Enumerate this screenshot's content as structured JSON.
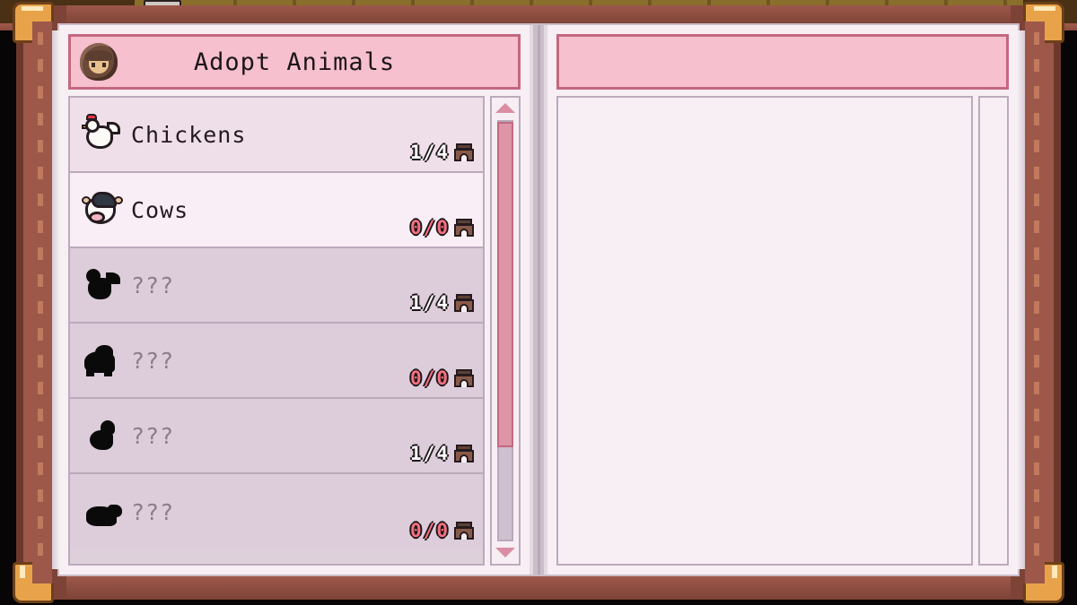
{
  "world": {
    "item_icon": "crown-item-icon"
  },
  "book": {
    "left_page": {
      "header": {
        "avatar_icon": "player-portrait-icon",
        "title": "Adopt Animals"
      },
      "rows": [
        {
          "icon": "chicken-icon",
          "label": "Chickens",
          "locked": false,
          "selected": false,
          "count": "1",
          "separator": "/",
          "capacity": "4",
          "count_state": "ok",
          "building_icon": "coop-icon"
        },
        {
          "icon": "cow-icon",
          "label": "Cows",
          "locked": false,
          "selected": true,
          "count": "0",
          "separator": "/",
          "capacity": "0",
          "count_state": "full",
          "building_icon": "barn-icon"
        },
        {
          "icon": "locked-chicken-silhouette-icon",
          "label": "???",
          "locked": true,
          "selected": false,
          "count": "1",
          "separator": "/",
          "capacity": "4",
          "count_state": "ok",
          "building_icon": "coop-icon"
        },
        {
          "icon": "locked-sheep-silhouette-icon",
          "label": "???",
          "locked": true,
          "selected": false,
          "count": "0",
          "separator": "/",
          "capacity": "0",
          "count_state": "full",
          "building_icon": "barn-icon"
        },
        {
          "icon": "locked-duck-silhouette-icon",
          "label": "???",
          "locked": true,
          "selected": false,
          "count": "1",
          "separator": "/",
          "capacity": "4",
          "count_state": "ok",
          "building_icon": "coop-icon"
        },
        {
          "icon": "locked-pig-silhouette-icon",
          "label": "???",
          "locked": true,
          "selected": false,
          "count": "0",
          "separator": "/",
          "capacity": "0",
          "count_state": "full",
          "building_icon": "barn-icon"
        }
      ],
      "scrollbar": {
        "up_arrow_icon": "scroll-up-arrow-icon",
        "down_arrow_icon": "scroll-down-arrow-icon",
        "thumb_top_percent": 0,
        "thumb_height_percent": 78
      }
    },
    "right_page": {
      "header": {
        "title": ""
      },
      "body": {
        "content": ""
      }
    }
  },
  "colors": {
    "header_fill": "#f6c0ce",
    "header_border": "#c4687f",
    "page_paper": "#f8eff5",
    "row_unlocked": "#efdfe9",
    "row_selected": "#f9eef6",
    "row_locked": "#ddcddb",
    "row_border": "#bcaabb",
    "scrollbar_thumb": "#dd95a7",
    "count_ok": "#ffffff",
    "count_full": "#f4707f",
    "leather": "#8d4b3d",
    "corner_gold": "#e8a34a"
  }
}
